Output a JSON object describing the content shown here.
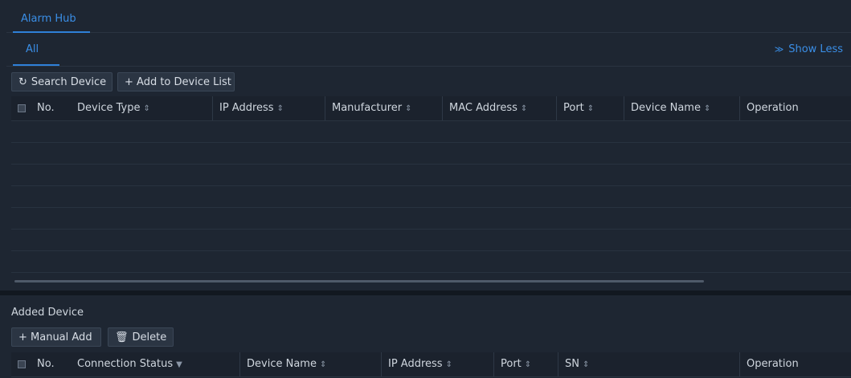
{
  "tabs": {
    "main": "Alarm Hub"
  },
  "subtabs": {
    "all": "All",
    "show_less": "Show Less"
  },
  "toolbar": {
    "search_device": "Search Device",
    "add_to_device_list": "+ Add to Device List"
  },
  "search_table": {
    "columns": [
      "No.",
      "Device Type",
      "IP Address",
      "Manufacturer",
      "MAC Address",
      "Port",
      "Device Name",
      "Operation"
    ],
    "rows": []
  },
  "added": {
    "title": "Added Device",
    "manual_add": "+ Manual Add",
    "delete": "Delete",
    "columns": [
      "No.",
      "Connection Status",
      "Device Name",
      "IP Address",
      "Port",
      "SN",
      "Operation"
    ],
    "rows": []
  },
  "icons": {
    "refresh": "refresh-icon",
    "trash": "trash-icon",
    "sort": "sort-icon",
    "filter": "filter-icon",
    "double-chevron-up": "double-chevron-up-icon"
  },
  "colors": {
    "accent": "#2f80d8",
    "bg": "#1e2632"
  }
}
